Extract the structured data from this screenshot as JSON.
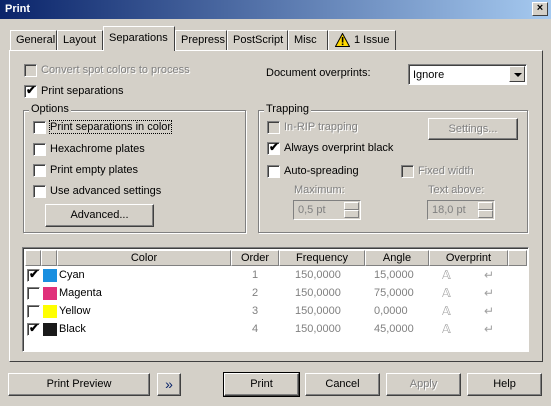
{
  "window": {
    "title": "Print",
    "close_glyph": "×"
  },
  "tabs": [
    {
      "label": "General"
    },
    {
      "label": "Layout"
    },
    {
      "label": "Separations"
    },
    {
      "label": "Prepress"
    },
    {
      "label": "PostScript"
    },
    {
      "label": "Misc"
    },
    {
      "label": "1 Issue"
    }
  ],
  "top": {
    "convert_spot": {
      "label": "Convert spot colors to process",
      "checked": false,
      "enabled": false
    },
    "print_separations": {
      "label": "Print separations",
      "checked": true
    },
    "doc_overprints_label": "Document overprints:",
    "doc_overprints_value": "Ignore"
  },
  "options": {
    "title": "Options",
    "items": [
      {
        "label": "Print separations in color",
        "checked": false
      },
      {
        "label": "Hexachrome plates",
        "checked": false
      },
      {
        "label": "Print empty plates",
        "checked": false
      },
      {
        "label": "Use advanced settings",
        "checked": false
      }
    ],
    "advanced_button": "Advanced..."
  },
  "trapping": {
    "title": "Trapping",
    "in_rip": {
      "label": "In-RIP trapping",
      "checked": false,
      "enabled": false
    },
    "settings_button": "Settings...",
    "always_overprint": {
      "label": "Always overprint black",
      "checked": true
    },
    "auto_spreading": {
      "label": "Auto-spreading",
      "checked": false
    },
    "fixed_width": {
      "label": "Fixed width",
      "checked": false,
      "enabled": false
    },
    "maximum_label": "Maximum:",
    "maximum_value": "0,5 pt",
    "text_above_label": "Text above:",
    "text_above_value": "18,0 pt"
  },
  "table": {
    "headers": [
      "Color",
      "Order",
      "Frequency",
      "Angle",
      "Overprint"
    ],
    "rows": [
      {
        "checked": true,
        "name": "Cyan",
        "swatch": "#1a8fe0",
        "order": "1",
        "frequency": "150,0000",
        "angle": "15,0000"
      },
      {
        "checked": false,
        "name": "Magenta",
        "swatch": "#e0307a",
        "order": "2",
        "frequency": "150,0000",
        "angle": "75,0000"
      },
      {
        "checked": false,
        "name": "Yellow",
        "swatch": "#ffff00",
        "order": "3",
        "frequency": "150,0000",
        "angle": "0,0000"
      },
      {
        "checked": true,
        "name": "Black",
        "swatch": "#1a1a1a",
        "order": "4",
        "frequency": "150,0000",
        "angle": "45,0000"
      }
    ]
  },
  "footer": {
    "print_preview": "Print Preview",
    "expand_glyph": "»",
    "print": "Print",
    "cancel": "Cancel",
    "apply": "Apply",
    "help": "Help"
  },
  "colors": {
    "titlebar_start": "#0a246a",
    "titlebar_end": "#a6caf0",
    "face": "#d4d0c8",
    "warning": "#ffd800"
  }
}
